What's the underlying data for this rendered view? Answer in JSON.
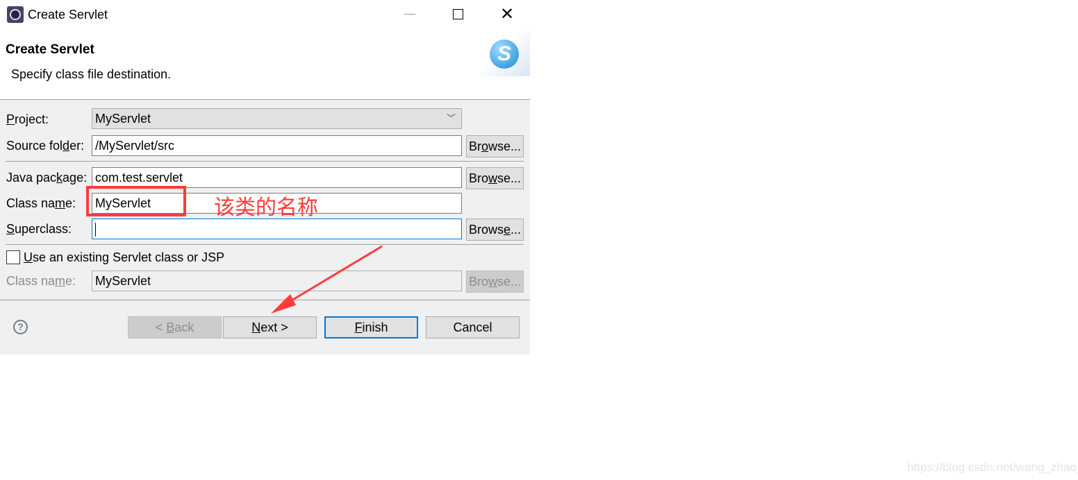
{
  "window": {
    "title": "Create Servlet",
    "app_icon": "eclipse-icon",
    "controls": [
      "minimize-icon",
      "maximize-icon",
      "close-icon"
    ]
  },
  "header": {
    "title": "Create Servlet",
    "subtitle": "Specify class file destination.",
    "logo": "servlet-s-logo-icon"
  },
  "form": {
    "project": {
      "label": [
        "",
        "P",
        "roject:"
      ],
      "value": "MyServlet"
    },
    "source_folder": {
      "label": [
        "Source fol",
        "d",
        "er:"
      ],
      "value": "/MyServlet/src",
      "browse": [
        "Br",
        "o",
        "wse..."
      ]
    },
    "java_package": {
      "label": [
        "Java pac",
        "k",
        "age:"
      ],
      "value": "com.test.servlet",
      "browse": [
        "Bro",
        "w",
        "se..."
      ]
    },
    "class_name": {
      "label": [
        "Class na",
        "m",
        "e:"
      ],
      "value": "MyServlet"
    },
    "superclass": {
      "label": [
        "",
        "S",
        "uperclass:"
      ],
      "value": "",
      "browse": [
        "Brows",
        "e",
        "..."
      ]
    },
    "use_existing": {
      "label": [
        "",
        "U",
        "se an existing Servlet class or JSP"
      ],
      "checked": false
    },
    "existing_class": {
      "label": [
        "Class na",
        "m",
        "e:"
      ],
      "value": "MyServlet",
      "browse": [
        "Bro",
        "w",
        "se..."
      ],
      "disabled": true
    }
  },
  "annotation": {
    "text": "该类的名称",
    "color": "#ff3b3b"
  },
  "buttons": {
    "back": [
      "< ",
      "B",
      "ack"
    ],
    "next": [
      "",
      "N",
      "ext >"
    ],
    "finish": [
      "",
      "F",
      "inish"
    ],
    "cancel": "Cancel",
    "help": "help-icon"
  },
  "watermark": "https://blog.csdn.net/wang_zhao_"
}
